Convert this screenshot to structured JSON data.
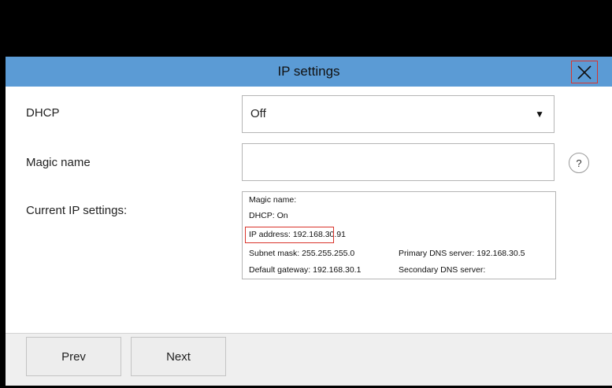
{
  "dialog": {
    "title": "IP settings",
    "close_icon": "close-x-icon"
  },
  "fields": {
    "dhcp": {
      "label": "DHCP",
      "value": "Off",
      "arrow_icon": "dropdown-arrow-icon"
    },
    "magic_name": {
      "label": "Magic name",
      "value": "",
      "help_label": "?"
    },
    "current": {
      "label": "Current IP settings:",
      "lines": {
        "magic_name": "Magic name:",
        "dhcp": "DHCP: On",
        "ip_address": "IP address: 192.168.30.91",
        "subnet_mask": "Subnet mask: 255.255.255.0",
        "primary_dns": "Primary DNS server: 192.168.30.5",
        "default_gateway": "Default gateway: 192.168.30.1",
        "secondary_dns": "Secondary DNS server:"
      }
    }
  },
  "footer": {
    "prev_label": "Prev",
    "next_label": "Next"
  },
  "colors": {
    "titlebar": "#5b9bd5",
    "highlight": "#d9342b",
    "footer": "#efefef"
  }
}
